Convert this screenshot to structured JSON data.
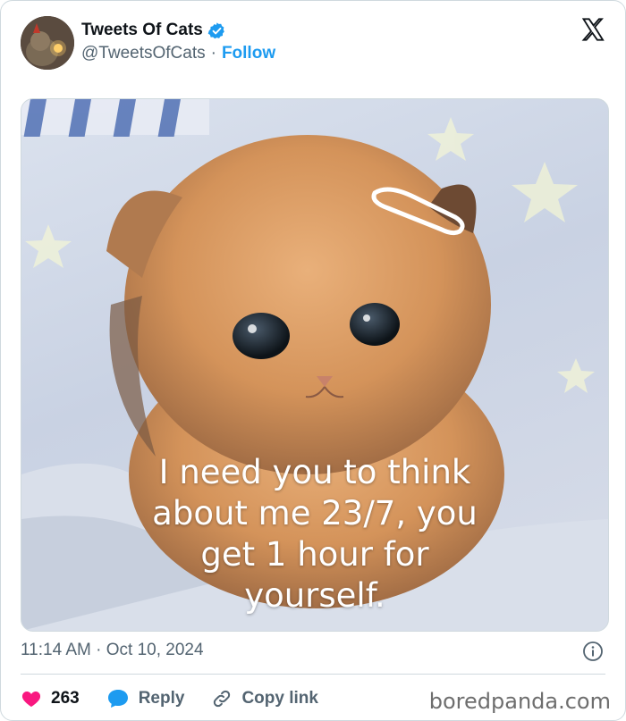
{
  "author": {
    "name": "Tweets Of Cats",
    "handle": "@TweetsOfCats",
    "separator": "·",
    "follow_label": "Follow",
    "verified_icon": "verified-badge-icon",
    "verified_color": "#1d9bf0"
  },
  "platform_icon": "x-logo-icon",
  "media": {
    "caption_lines": [
      "I need you to think",
      "about me 23/7, you",
      "get 1 hour for",
      "yourself."
    ]
  },
  "timestamp": {
    "time": "11:14 AM",
    "separator": "·",
    "date": "Oct 10, 2024"
  },
  "actions": {
    "like_count": "263",
    "reply_label": "Reply",
    "copy_label": "Copy link",
    "like_color": "#f91880",
    "reply_color": "#1d9bf0"
  },
  "watermark": "boredpanda.com"
}
